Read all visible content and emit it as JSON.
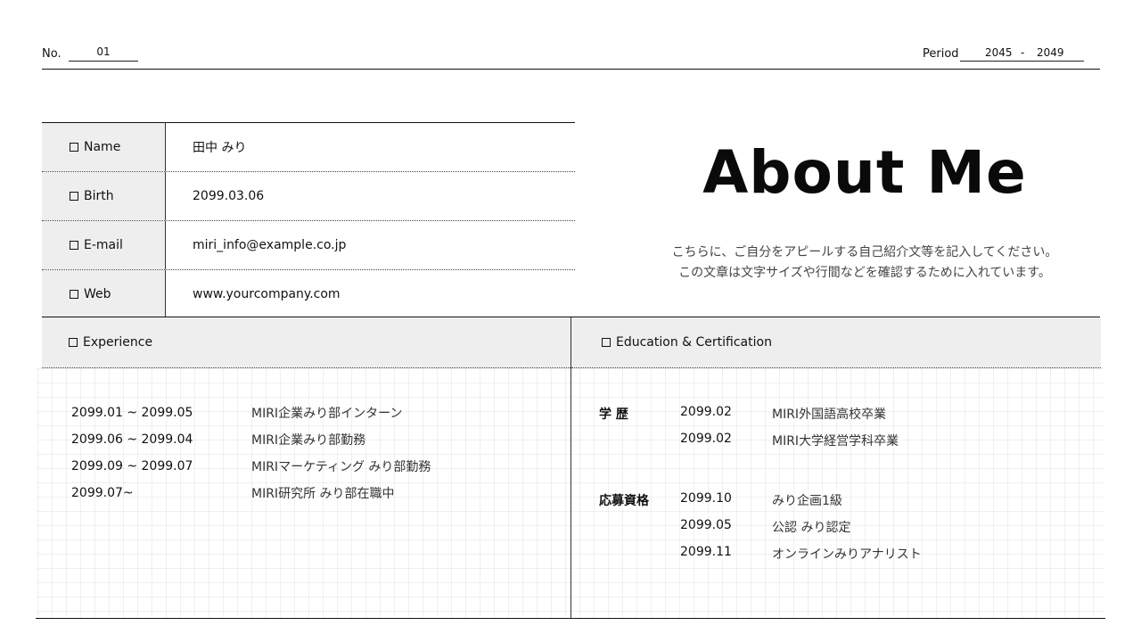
{
  "header": {
    "no_label": "No.",
    "no_value": "01",
    "period_label": "Period",
    "period_start": "2045",
    "period_sep": "-",
    "period_end": "2049"
  },
  "profile": {
    "rows": [
      {
        "label": "Name",
        "value": "田中 みり"
      },
      {
        "label": "Birth",
        "value": "2099.03.06"
      },
      {
        "label": "E-mail",
        "value": "miri_info@example.co.jp"
      },
      {
        "label": "Web",
        "value": "www.yourcompany.com"
      }
    ]
  },
  "about": {
    "title": "About Me",
    "line1": "こちらに、ご自分をアピールする自己紹介文等を記入してください。",
    "line2": "この文章は文字サイズや行間などを確認するために入れています。"
  },
  "experience": {
    "heading": "Experience",
    "items": [
      {
        "date": "2099.01 ~ 2099.05",
        "desc": "MIRI企業みり部インターン"
      },
      {
        "date": "2099.06 ~ 2099.04",
        "desc": "MIRI企業みり部勤務"
      },
      {
        "date": "2099.09 ~ 2099.07",
        "desc": "MIRIマーケティング みり部勤務"
      },
      {
        "date": "2099.07~",
        "desc": "MIRI研究所 みり部在職中"
      }
    ]
  },
  "education": {
    "heading": "Education & Certification",
    "groups": [
      {
        "category": "学 歴",
        "items": [
          {
            "date": "2099.02",
            "desc": "MIRI外国語高校卒業"
          },
          {
            "date": "2099.02",
            "desc": "MIRI大学経営学科卒業"
          }
        ]
      },
      {
        "category": "応募資格",
        "items": [
          {
            "date": "2099.10",
            "desc": "みり企画1級"
          },
          {
            "date": "2099.05",
            "desc": "公認 みり認定"
          },
          {
            "date": "2099.11",
            "desc": "オンラインみりアナリスト"
          }
        ]
      }
    ]
  }
}
